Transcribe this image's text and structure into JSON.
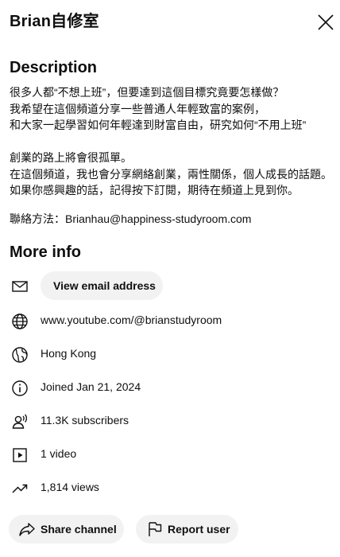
{
  "header": {
    "channel_name": "Brian自修室"
  },
  "description": {
    "heading": "Description",
    "text": "很多人都“不想上班”，但要達到這個目標究竟要怎樣做？\n我希望在這個頻道分享一些普通人年輕致富的案例，\n和大家一起學習如何年輕達到財富自由，研究如何“不用上班”\n\n創業的路上將會很孤單。\n在這個頻道，我也會分享網絡創業，兩性關係，個人成長的話題。\n如果你感興趣的話，記得按下訂閱，期待在頻道上見到你。",
    "contact": "聯絡方法：Brianhau@happiness-studyroom.com"
  },
  "more_info": {
    "heading": "More info",
    "email_button": "View email address",
    "url": "www.youtube.com/@brianstudyroom",
    "location": "Hong Kong",
    "joined": "Joined Jan 21, 2024",
    "subscribers": "11.3K subscribers",
    "videos": "1 video",
    "views": "1,814 views"
  },
  "actions": {
    "share": "Share channel",
    "report": "Report user"
  },
  "icons": {
    "close": "close-icon",
    "email": "mail-icon",
    "website": "globe-icon",
    "location": "location-globe-icon",
    "joined": "info-icon",
    "subscribers": "person-icon",
    "videos": "play-icon",
    "views": "trending-icon",
    "share": "share-icon",
    "report": "flag-icon"
  }
}
